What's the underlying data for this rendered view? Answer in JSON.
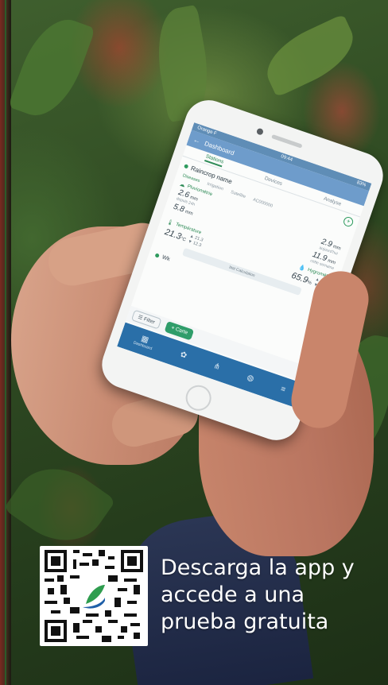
{
  "phone_app": {
    "status": {
      "left": "Orange F",
      "time": "09:44",
      "right": "83%"
    },
    "appbar_title": "Dashboard",
    "tabs": [
      "Stations",
      "Devices",
      "Analyse"
    ],
    "station_name": "Raincrop name",
    "subtabs": [
      "Diseases",
      "Irrigation",
      "Satellite",
      "AC000000"
    ],
    "precip_label": "Pluviométrie",
    "precip_value": "2.6",
    "precip_sub": "depuis 24h",
    "precip_value2": "5.8",
    "precip_right_value": "2.9",
    "precip_right_sub": "aujourd'hui",
    "precip_right_value2": "11.9",
    "precip_right_sub2": "cette semaine",
    "unit_mm": "mm",
    "temp_label": "Température",
    "temp_value": "21.3",
    "temp_unit": "°C",
    "temp_max": "▲ 21.3",
    "temp_min": "▼ 12.3",
    "hygro_label": "Hygrométrie",
    "hygro_value": "65.9",
    "hygro_unit": "%",
    "hygro_max": "▲ 95.3",
    "hygro_min": "▼ 65.5",
    "last_calc": "last Calculation",
    "second_station": "Wk",
    "filter_label": "Filter",
    "chip_carte": "Carte",
    "nav": [
      {
        "icon": "▦",
        "label": "Dashboard"
      },
      {
        "icon": "✿",
        "label": "Alerts"
      },
      {
        "icon": "⋔",
        "label": "Network"
      },
      {
        "icon": "◍",
        "label": "Map"
      },
      {
        "icon": "≡",
        "label": "More"
      }
    ]
  },
  "promo": {
    "line1": "Descarga la app y",
    "line2": "accede a una",
    "line3": "prueba gratuita"
  },
  "colors": {
    "accent_green": "#2e8b57",
    "app_blue": "#2a6fa8",
    "text_white": "#ffffff"
  }
}
